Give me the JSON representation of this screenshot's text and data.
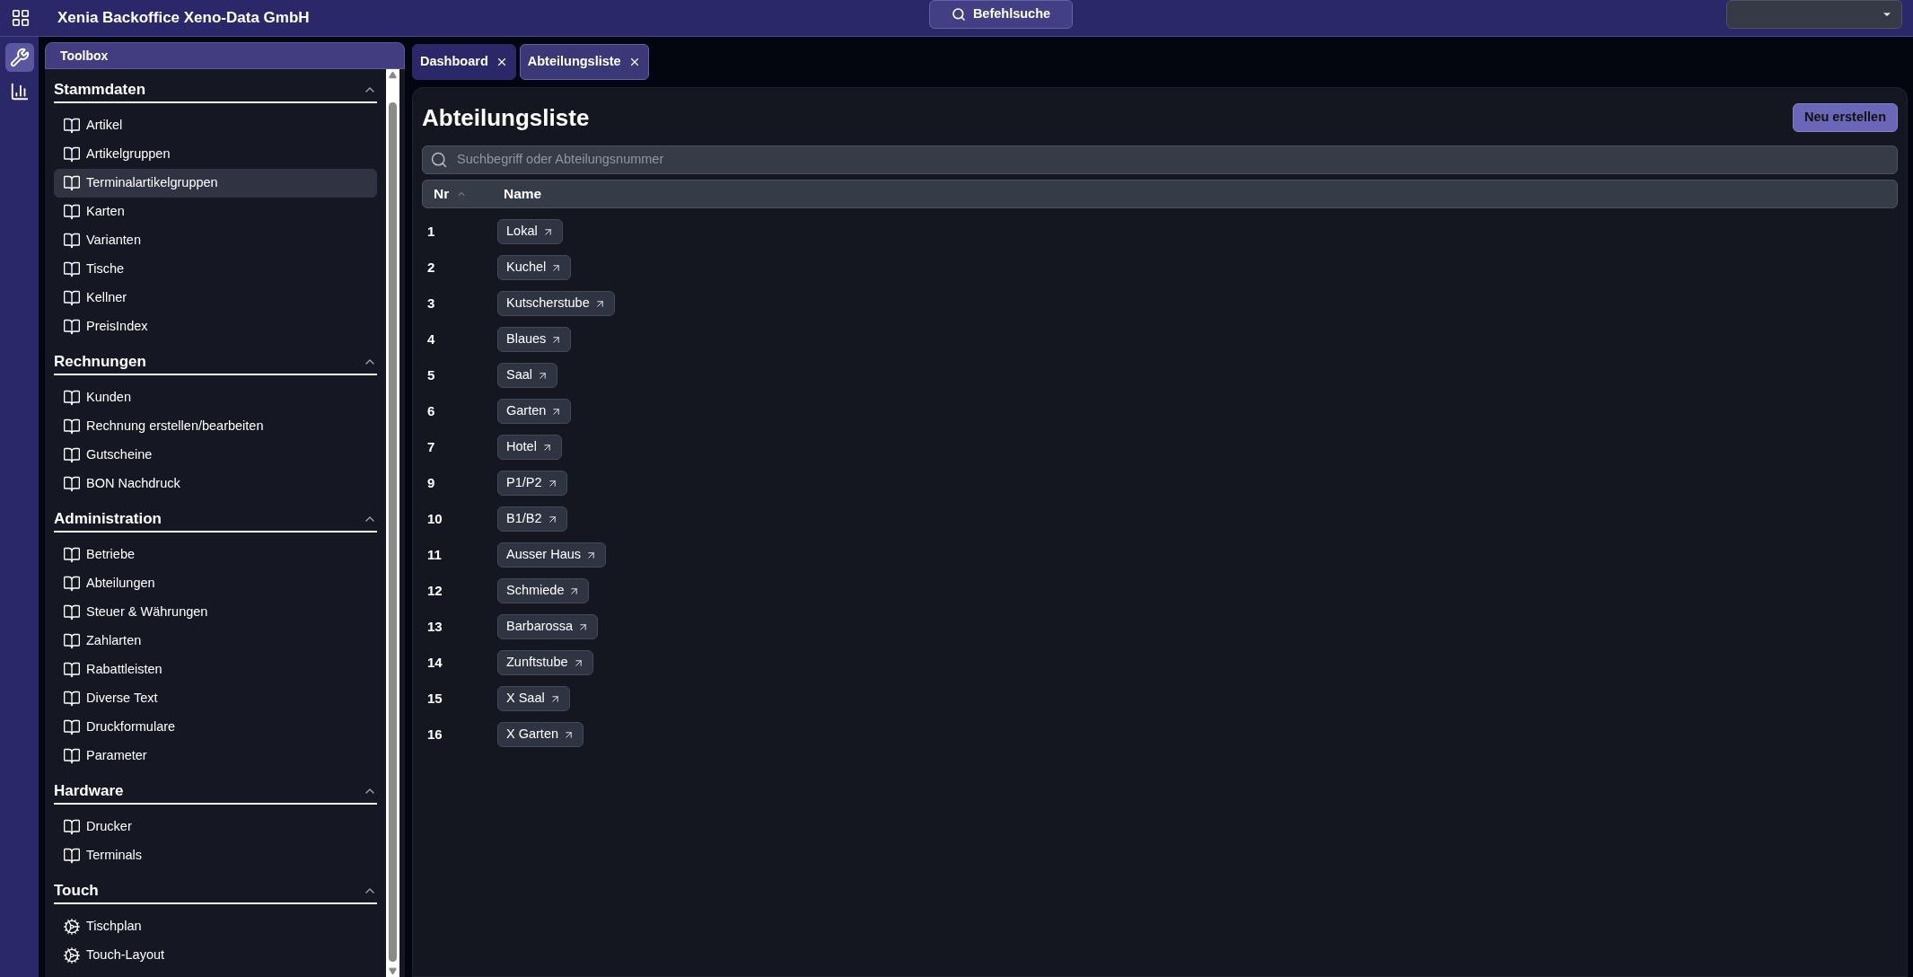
{
  "app_title": "Xenia Backoffice Xeno-Data GmbH",
  "command_search": "Befehlsuche",
  "rail": [
    {
      "kind": "tools",
      "selected": true
    },
    {
      "kind": "chart",
      "selected": false
    }
  ],
  "toolbox": {
    "title": "Toolbox",
    "sections": [
      {
        "title": "Stammdaten",
        "expanded": true,
        "items": [
          {
            "label": "Artikel",
            "kind": "book",
            "selected": false
          },
          {
            "label": "Artikelgruppen",
            "kind": "book",
            "selected": false
          },
          {
            "label": "Terminalartikelgruppen",
            "kind": "book",
            "selected": true
          },
          {
            "label": "Karten",
            "kind": "book",
            "selected": false
          },
          {
            "label": "Varianten",
            "kind": "book",
            "selected": false
          },
          {
            "label": "Tische",
            "kind": "book",
            "selected": false
          },
          {
            "label": "Kellner",
            "kind": "book",
            "selected": false
          },
          {
            "label": "PreisIndex",
            "kind": "book",
            "selected": false
          }
        ]
      },
      {
        "title": "Rechnungen",
        "expanded": true,
        "items": [
          {
            "label": "Kunden",
            "kind": "book",
            "selected": false
          },
          {
            "label": "Rechnung erstellen/bearbeiten",
            "kind": "book",
            "selected": false
          },
          {
            "label": "Gutscheine",
            "kind": "book",
            "selected": false
          },
          {
            "label": "BON Nachdruck",
            "kind": "book",
            "selected": false
          }
        ]
      },
      {
        "title": "Administration",
        "expanded": true,
        "items": [
          {
            "label": "Betriebe",
            "kind": "book",
            "selected": false
          },
          {
            "label": "Abteilungen",
            "kind": "book",
            "selected": false
          },
          {
            "label": "Steuer & Währungen",
            "kind": "book",
            "selected": false
          },
          {
            "label": "Zahlarten",
            "kind": "book",
            "selected": false
          },
          {
            "label": "Rabattleisten",
            "kind": "book",
            "selected": false
          },
          {
            "label": "Diverse Text",
            "kind": "book",
            "selected": false
          },
          {
            "label": "Druckformulare",
            "kind": "book",
            "selected": false
          },
          {
            "label": "Parameter",
            "kind": "book",
            "selected": false
          }
        ]
      },
      {
        "title": "Hardware",
        "expanded": true,
        "items": [
          {
            "label": "Drucker",
            "kind": "book",
            "selected": false
          },
          {
            "label": "Terminals",
            "kind": "book",
            "selected": false
          }
        ]
      },
      {
        "title": "Touch",
        "expanded": true,
        "items": [
          {
            "label": "Tischplan",
            "kind": "gear",
            "selected": false
          },
          {
            "label": "Touch-Layout",
            "kind": "gear",
            "selected": false
          }
        ]
      }
    ]
  },
  "tabs": [
    {
      "label": "Dashboard",
      "selected": false
    },
    {
      "label": "Abteilungsliste",
      "selected": true
    }
  ],
  "page": {
    "title": "Abteilungsliste",
    "new_button": "Neu erstellen",
    "search": {
      "placeholder": "Suchbegriff oder Abteilungsnummer"
    },
    "columns": [
      {
        "label": "Nr",
        "sorted_ascending": true
      },
      {
        "label": "Name"
      }
    ],
    "rows": [
      {
        "nr": "1",
        "name": "Lokal"
      },
      {
        "nr": "2",
        "name": "Kuchel"
      },
      {
        "nr": "3",
        "name": "Kutscherstube"
      },
      {
        "nr": "4",
        "name": "Blaues"
      },
      {
        "nr": "5",
        "name": "Saal"
      },
      {
        "nr": "6",
        "name": "Garten"
      },
      {
        "nr": "7",
        "name": "Hotel"
      },
      {
        "nr": "9",
        "name": "P1/P2"
      },
      {
        "nr": "10",
        "name": "B1/B2"
      },
      {
        "nr": "11",
        "name": "Ausser Haus"
      },
      {
        "nr": "12",
        "name": "Schmiede"
      },
      {
        "nr": "13",
        "name": "Barbarossa"
      },
      {
        "nr": "14",
        "name": "Zunftstube"
      },
      {
        "nr": "15",
        "name": "X Saal"
      },
      {
        "nr": "16",
        "name": "X Garten"
      }
    ]
  }
}
